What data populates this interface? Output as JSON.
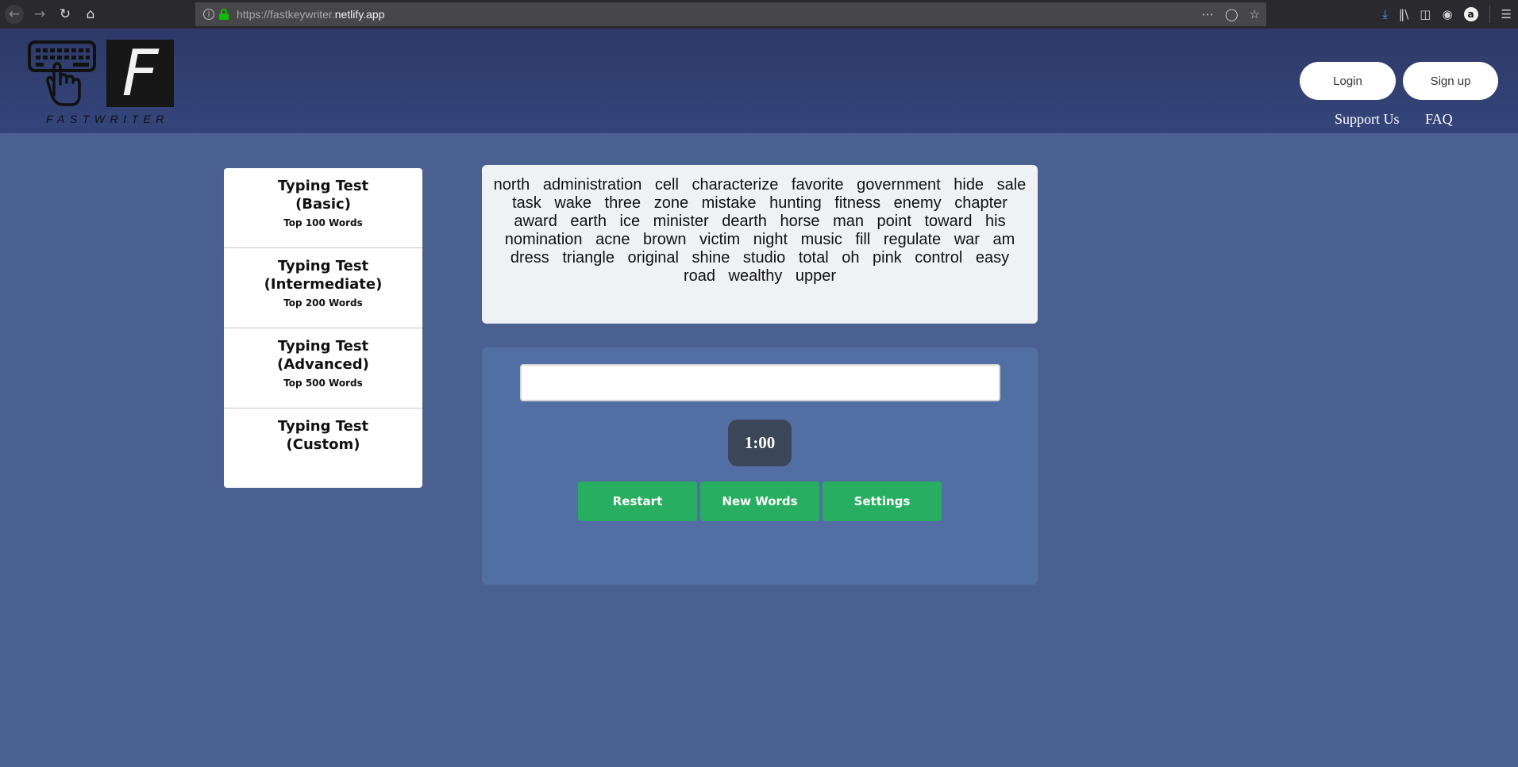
{
  "browser": {
    "url_prefix": "https://fastkeywriter.",
    "url_host": "netlify.app",
    "icons": [
      "back-arrow-icon",
      "forward-arrow-icon",
      "reload-icon",
      "home-icon",
      "info-icon",
      "lock-icon",
      "more-icon",
      "pocket-icon",
      "bookmark-star-icon",
      "download-icon",
      "library-icon",
      "sidebar-icon",
      "account-icon",
      "amazon-icon",
      "menu-icon"
    ],
    "amazon_label": "a"
  },
  "header": {
    "logo_letter": "F",
    "logo_text": "FASTWRITER",
    "login_label": "Login",
    "signup_label": "Sign up",
    "support_label": "Support Us",
    "faq_label": "FAQ"
  },
  "sidebar": {
    "items": [
      {
        "title_line1": "Typing Test",
        "title_line2": "(Basic)",
        "subtitle": "Top 100 Words"
      },
      {
        "title_line1": "Typing Test",
        "title_line2": "(Intermediate)",
        "subtitle": "Top 200 Words"
      },
      {
        "title_line1": "Typing Test",
        "title_line2": "(Advanced)",
        "subtitle": "Top 500 Words"
      },
      {
        "title_line1": "Typing Test",
        "title_line2": "(Custom)",
        "subtitle": ""
      }
    ]
  },
  "words": {
    "text": "north administration cell characterize favorite government hide sale task wake three zone mistake hunting fitness enemy chapter award earth ice minister dearth horse man point toward his nomination acne brown victim night music fill regulate war am dress triangle original shine studio total oh pink control easy road wealthy upper"
  },
  "typing": {
    "input_value": "",
    "timer": "1:00",
    "restart_label": "Restart",
    "new_words_label": "New Words",
    "settings_label": "Settings"
  },
  "colors": {
    "page_bg": "#4a6090",
    "header_bg": "#2e3a68",
    "panel_bg": "#526fa3",
    "button_green": "#27ae60",
    "timer_bg": "#3b4658"
  }
}
